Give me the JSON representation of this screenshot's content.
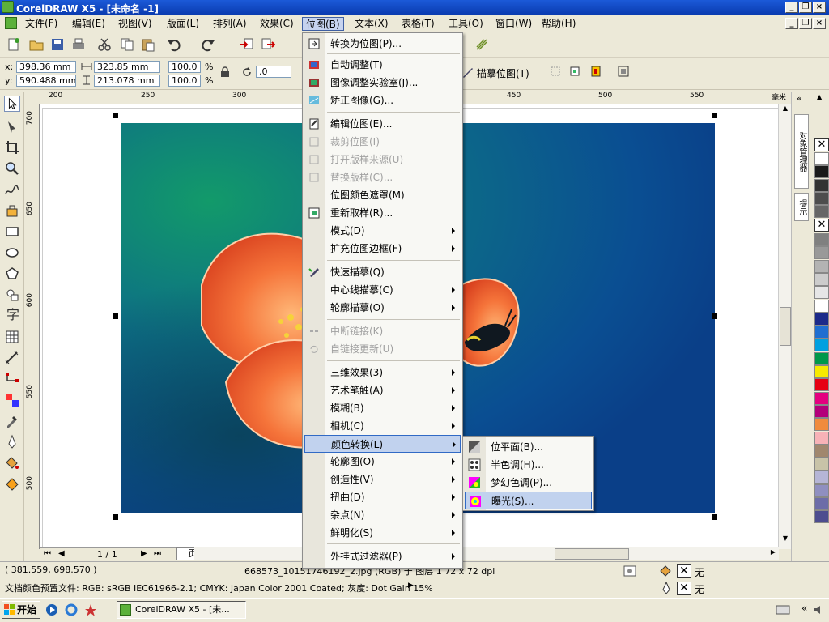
{
  "window": {
    "title": "CorelDRAW X5 - [未命名 -1]"
  },
  "menubar": {
    "items": [
      "文件(F)",
      "编辑(E)",
      "视图(V)",
      "版面(L)",
      "排列(A)",
      "效果(C)",
      "位图(B)",
      "文本(X)",
      "表格(T)",
      "工具(O)",
      "窗口(W)",
      "帮助(H)"
    ]
  },
  "propbar": {
    "x_label": "x:",
    "x": "398.36 mm",
    "y_label": "y:",
    "y": "590.488 mm",
    "w": "323.85 mm",
    "h": "213.078 mm",
    "sx": "100.0",
    "sy": "100.0",
    "pct": "%",
    "angle": ".0",
    "trace": "描摹位图(T)"
  },
  "ruler": {
    "h_ticks": [
      "200",
      "250",
      "300",
      "450",
      "500",
      "550"
    ],
    "unit": "毫米",
    "v_ticks": [
      "700",
      "650",
      "600",
      "550",
      "500"
    ]
  },
  "bitmap_menu": {
    "items": [
      {
        "label": "转换为位图(P)...",
        "disabled": false,
        "sub": false,
        "icon": "convert-bitmap-icon"
      },
      {
        "label": "自动调整(T)",
        "disabled": false,
        "sub": false,
        "icon": "auto-adjust-icon"
      },
      {
        "label": "图像调整实验室(J)...",
        "disabled": false,
        "sub": false,
        "icon": "image-lab-icon"
      },
      {
        "label": "矫正图像(G)...",
        "disabled": false,
        "sub": false,
        "icon": "straighten-icon"
      },
      {
        "label": "编辑位图(E)...",
        "disabled": false,
        "sub": false,
        "icon": "edit-bitmap-icon"
      },
      {
        "label": "裁剪位图(I)",
        "disabled": true,
        "sub": false,
        "icon": "crop-bitmap-icon"
      },
      {
        "label": "打开版样来源(U)",
        "disabled": true,
        "sub": false,
        "icon": "open-source-icon"
      },
      {
        "label": "替换版样(C)...",
        "disabled": true,
        "sub": false,
        "icon": "replace-icon"
      },
      {
        "label": "位图颜色遮罩(M)",
        "disabled": false,
        "sub": false,
        "icon": ""
      },
      {
        "label": "重新取样(R)...",
        "disabled": false,
        "sub": false,
        "icon": "resample-icon"
      },
      {
        "label": "模式(D)",
        "disabled": false,
        "sub": true,
        "icon": ""
      },
      {
        "label": "扩充位图边框(F)",
        "disabled": false,
        "sub": true,
        "icon": ""
      },
      {
        "label": "快速描摹(Q)",
        "disabled": false,
        "sub": false,
        "icon": "quick-trace-icon"
      },
      {
        "label": "中心线描摹(C)",
        "disabled": false,
        "sub": true,
        "icon": ""
      },
      {
        "label": "轮廓描摹(O)",
        "disabled": false,
        "sub": true,
        "icon": ""
      },
      {
        "label": "中断链接(K)",
        "disabled": true,
        "sub": false,
        "icon": "break-link-icon"
      },
      {
        "label": "自链接更新(U)",
        "disabled": true,
        "sub": false,
        "icon": "update-link-icon"
      },
      {
        "label": "三维效果(3)",
        "disabled": false,
        "sub": true,
        "icon": ""
      },
      {
        "label": "艺术笔触(A)",
        "disabled": false,
        "sub": true,
        "icon": ""
      },
      {
        "label": "模糊(B)",
        "disabled": false,
        "sub": true,
        "icon": ""
      },
      {
        "label": "相机(C)",
        "disabled": false,
        "sub": true,
        "icon": ""
      },
      {
        "label": "颜色转换(L)",
        "disabled": false,
        "sub": true,
        "icon": "",
        "highlight": true
      },
      {
        "label": "轮廓图(O)",
        "disabled": false,
        "sub": true,
        "icon": ""
      },
      {
        "label": "创造性(V)",
        "disabled": false,
        "sub": true,
        "icon": ""
      },
      {
        "label": "扭曲(D)",
        "disabled": false,
        "sub": true,
        "icon": ""
      },
      {
        "label": "杂点(N)",
        "disabled": false,
        "sub": true,
        "icon": ""
      },
      {
        "label": "鲜明化(S)",
        "disabled": false,
        "sub": true,
        "icon": ""
      },
      {
        "label": "外挂式过滤器(P)",
        "disabled": false,
        "sub": true,
        "icon": ""
      }
    ]
  },
  "color_submenu": {
    "items": [
      {
        "label": "位平面(B)...",
        "icon": "bit-plane-icon"
      },
      {
        "label": "半色调(H)...",
        "icon": "halftone-icon"
      },
      {
        "label": "梦幻色调(P)...",
        "icon": "psychedelic-icon"
      },
      {
        "label": "曝光(S)...",
        "icon": "solarize-icon",
        "highlight": true
      }
    ]
  },
  "pagebar": {
    "page_count": "1 / 1",
    "page_tab": "页 1"
  },
  "status": {
    "coords": "( 381.559, 698.570 )",
    "object": "668573_1015174619​2_2.jpg (RGB) 于 图层 1 72 x 72 dpi",
    "profile": "文档颜色预置文件: RGB: sRGB IEC61966-2.1; CMYK: Japan Color 2001 Coated; 灰度: Dot Gain 15%",
    "fill_none": "无",
    "outline_none": "无"
  },
  "taskbar": {
    "start": "开始",
    "task": "CorelDRAW X5 - [未..."
  },
  "docker": {
    "tab1": "对象管理器",
    "tab2": "提示"
  },
  "palette": [
    "#ffffff",
    "#1a1a1a",
    "#333333",
    "#4d4d4d",
    "#666666",
    "#808080",
    "#999999",
    "#b3b3b3",
    "#cccccc",
    "#e6e6e6",
    "#ffffff",
    "#1c2a8a",
    "#1f6fd1",
    "#00a0e0",
    "#00984a",
    "#f7ea00",
    "#e60012",
    "#e4007f",
    "#b3007a",
    "#f08b3d",
    "#f7b2b7",
    "#a0876e",
    "#c8c3a8",
    "#b5b5d6",
    "#8f8fc0",
    "#6d6da8",
    "#4d4d8f"
  ]
}
